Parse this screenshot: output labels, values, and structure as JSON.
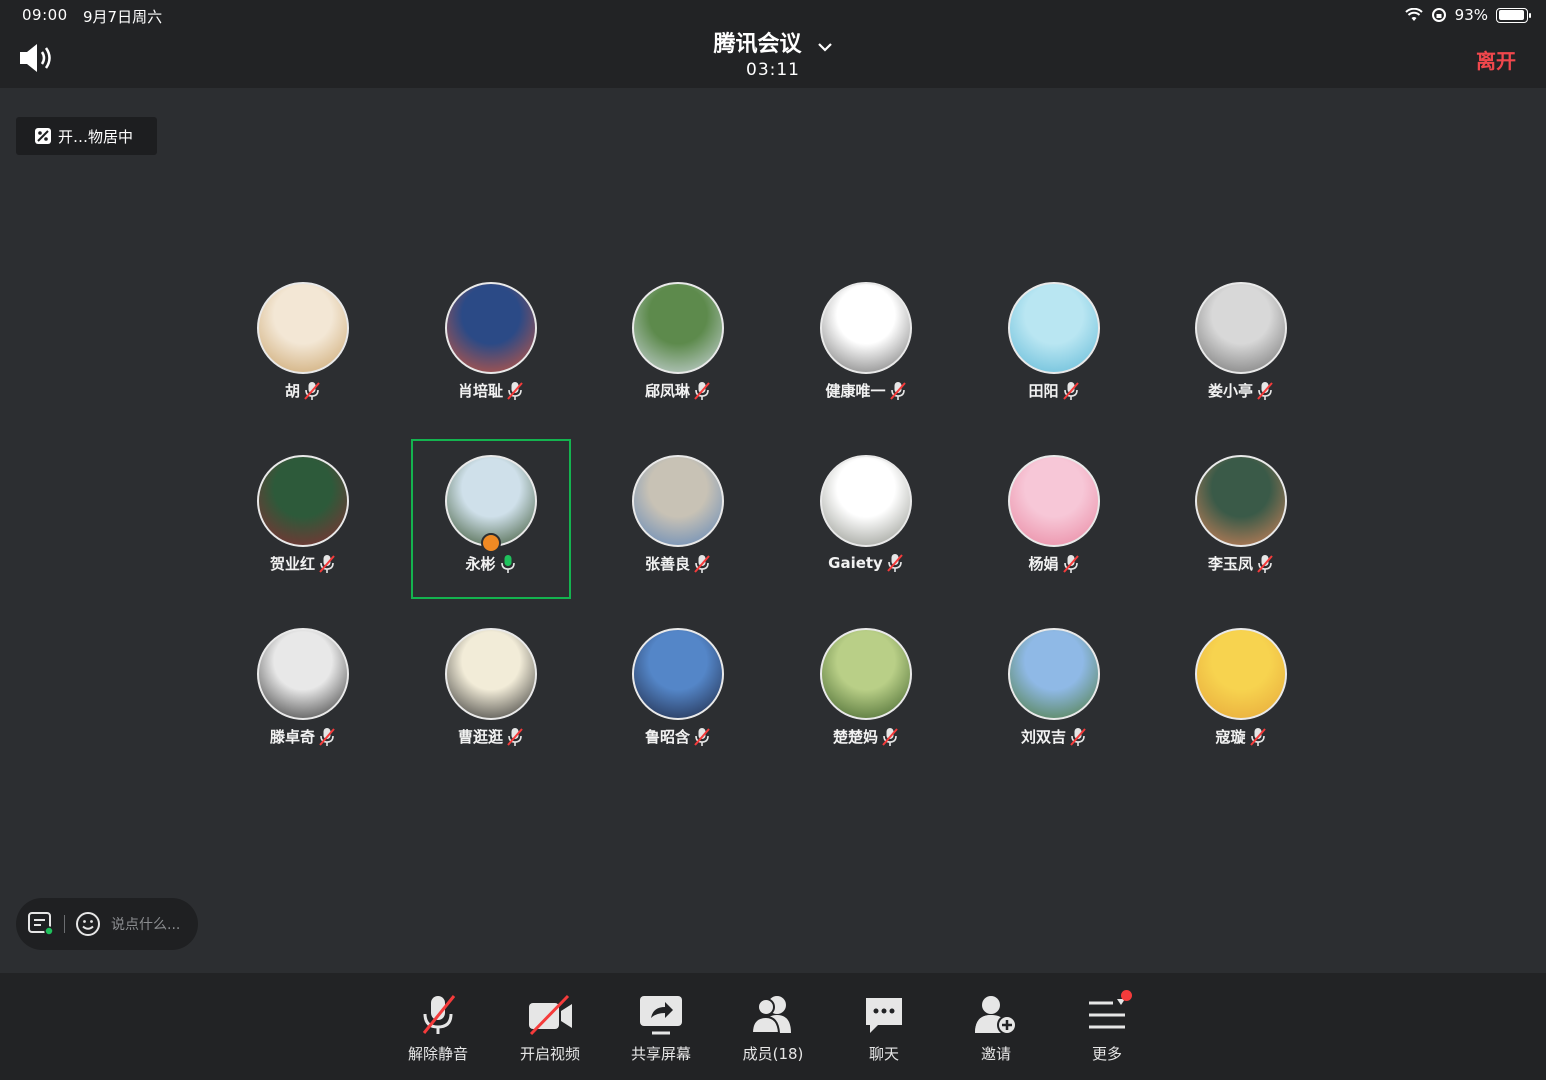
{
  "status_bar": {
    "time": "09:00",
    "date": "9月7日周六",
    "battery": "93%",
    "battery_level": 0.93
  },
  "header": {
    "title": "腾讯会议",
    "duration": "03:11",
    "leave_label": "离开"
  },
  "recording_badge": {
    "text": "开…物居中"
  },
  "participants": [
    {
      "name": "胡",
      "mic": "muted",
      "color_a": "#f3e7d5",
      "color_b": "#c9a269"
    },
    {
      "name": "肖培耻",
      "mic": "muted",
      "color_a": "#2b4a86",
      "color_b": "#d0573c"
    },
    {
      "name": "郈凤琳",
      "mic": "muted",
      "color_a": "#5d8a4c",
      "color_b": "#cfd8e0"
    },
    {
      "name": "健康唯一",
      "mic": "muted",
      "color_a": "#ffffff",
      "color_b": "#6d6d6d"
    },
    {
      "name": "田阳",
      "mic": "muted",
      "color_a": "#b9e6f2",
      "color_b": "#5fb8d6"
    },
    {
      "name": "娄小亭",
      "mic": "muted",
      "color_a": "#d8d8d8",
      "color_b": "#6f6f6f"
    },
    {
      "name": "贺业红",
      "mic": "muted",
      "color_a": "#2d5a3a",
      "color_b": "#8a2c33"
    },
    {
      "name": "永彬",
      "mic": "on",
      "color_a": "#cfe0ea",
      "color_b": "#35502c"
    },
    {
      "name": "张善良",
      "mic": "muted",
      "color_a": "#c8c2b5",
      "color_b": "#5c84b8"
    },
    {
      "name": "Gaiety",
      "mic": "muted",
      "color_a": "#ffffff",
      "color_b": "#8b8e86"
    },
    {
      "name": "杨娟",
      "mic": "muted",
      "color_a": "#f7c7d7",
      "color_b": "#e8859f"
    },
    {
      "name": "李玉凤",
      "mic": "muted",
      "color_a": "#3a5a48",
      "color_b": "#d6845a"
    },
    {
      "name": "滕卓奇",
      "mic": "muted",
      "color_a": "#e8e8e8",
      "color_b": "#2f2f2f"
    },
    {
      "name": "曹逛逛",
      "mic": "muted",
      "color_a": "#f2ecd8",
      "color_b": "#2a2a2a"
    },
    {
      "name": "鲁昭含",
      "mic": "muted",
      "color_a": "#5486c8",
      "color_b": "#1d2540"
    },
    {
      "name": "楚楚妈",
      "mic": "muted",
      "color_a": "#b9cf87",
      "color_b": "#3c5e28"
    },
    {
      "name": "刘双吉",
      "mic": "muted",
      "color_a": "#8fb9e6",
      "color_b": "#4d7a3a"
    },
    {
      "name": "寇璇",
      "mic": "muted",
      "color_a": "#f7d34f",
      "color_b": "#e6a63a"
    }
  ],
  "chat": {
    "placeholder": "说点什么..."
  },
  "toolbar": {
    "unmute": "解除静音",
    "video": "开启视频",
    "share": "共享屏幕",
    "members": "成员(18)",
    "chat": "聊天",
    "invite": "邀请",
    "more": "更多"
  },
  "colors": {
    "background": "#2c2e31",
    "bar": "#222325",
    "leave": "#f0474c",
    "active_border": "#14b34f",
    "mute_red": "#f53b3b",
    "mic_green": "#1fc15c"
  }
}
